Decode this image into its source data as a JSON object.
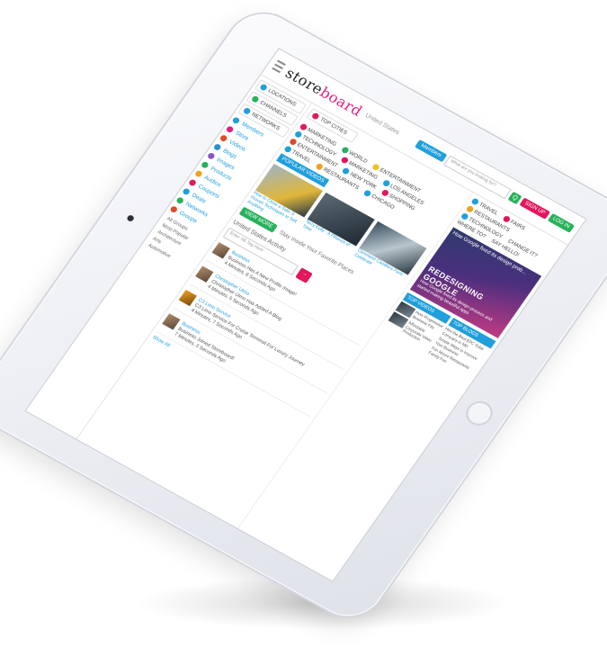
{
  "header": {
    "logo_prefix": "store",
    "logo_accent": "board",
    "country": "United States",
    "members_label": "Members",
    "search_placeholder": "What are you looking for?",
    "go_label": "Q",
    "signup_label": "SIGN UP",
    "login_label": "LOG IN"
  },
  "sidebar": {
    "locations_label": "LOCATIONS",
    "channels_label": "CHANNELS",
    "networks_label": "NETWORKS",
    "items": [
      {
        "label": "Members",
        "color": "#1f9fdc"
      },
      {
        "label": "Store",
        "color": "#e41f82"
      },
      {
        "label": "Videos",
        "color": "#e04a2a"
      },
      {
        "label": "Blogs",
        "color": "#2b8fd6"
      },
      {
        "label": "Images",
        "color": "#8a55c9"
      },
      {
        "label": "Products",
        "color": "#27b15a"
      },
      {
        "label": "Audios",
        "color": "#f0a020"
      },
      {
        "label": "Coupons",
        "color": "#e5155e"
      },
      {
        "label": "Deals",
        "color": "#1f9fdc"
      },
      {
        "label": "Networks",
        "color": "#27b15a"
      },
      {
        "label": "Groups",
        "color": "#e04a2a"
      }
    ],
    "groups": [
      "All Groups",
      "Most Popular",
      "Architecture",
      "Arts",
      "Automotive"
    ]
  },
  "main": {
    "top_cities_label": "TOP CITIES",
    "categories": [
      "MARKETING",
      "WORLD",
      "ENTERTAINMENT",
      "TECHNOLOGY",
      "MARKETING",
      "LOS ANGELES",
      "ENTERTAINMENT",
      "NEW YORK",
      "SHOPPING",
      "TRAVEL",
      "RESTAURANTS",
      "CHICAGO"
    ],
    "popular_videos_label": "POPULAR VIDEOS",
    "videos": [
      {
        "caption": "How to Close a Sale: 5 Proven Techniques to Sell Anything"
      },
      {
        "caption": "Terry Kelly - A Pittance of Time"
      },
      {
        "caption": "Cleveland Cavaliers Fans Celebrate"
      }
    ],
    "view_more_label": "VIEW MORE",
    "stay_inside_label": "Stay Inside Your Favorite Places",
    "activity_title": "United States Activity",
    "enter_tag_label": "Enter SB Tag Here",
    "activities": [
      {
        "name": "Business",
        "text": "Business Has A New Profile Image!",
        "time": "4 Minutes, 8 Seconds Ago"
      },
      {
        "name": "Christopher Ulmo",
        "text": "Christopher Ulmo Has Added A Blog",
        "time": "4 Minutes, 5 Seconds Ago"
      },
      {
        "name": "C3 Limo Service",
        "text": "C3 Limo Service For Cruise Terminal For Luxury Journey",
        "time": "4 Minutes, 7 Seconds Ago"
      },
      {
        "name": "Business",
        "text": "Business Joined Storeboard!",
        "time": "7 Minutes, 3 Seconds Ago"
      }
    ],
    "show_all_label": "Show All"
  },
  "right": {
    "travel_label": "TRAVEL",
    "fairs_label": "FAIRS",
    "restaurants_label": "RESTAURANTS",
    "technology_label": "TECHNOLOGY",
    "change_it_label": "CHANGE IT?",
    "where_to_label": "WHERE TO?",
    "say_hello_label": "SAY HELLO!",
    "feature_head": "How Google fixed its design prob...",
    "feature_title": "REDESIGNING GOOGLE",
    "feature_sub": "How Google fixed its design process and started making beautiful apps",
    "top_videos_label": "TOP VIDEOS",
    "top_blogs_label": "TOP BLOGS",
    "top_videos": [
      "How Progressive Business Fits",
      "Affordable Corporate Video Production"
    ],
    "top_blogs": [
      "Hire the Best EPC Solar Company in MD",
      "Simple Ways to Improve Your Business",
      "Fun Mount Restaurants Family Fun"
    ]
  }
}
